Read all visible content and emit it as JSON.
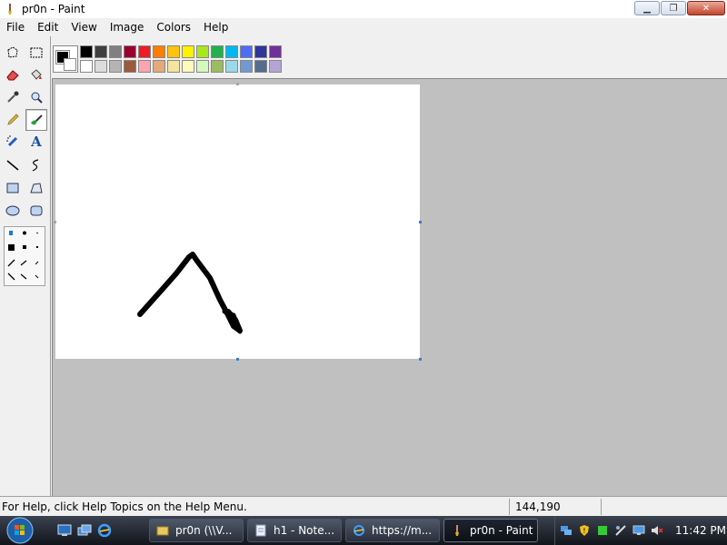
{
  "window": {
    "title": "pr0n - Paint",
    "minimize_icon": "minimize-icon",
    "restore_icon": "restore-icon",
    "close_icon": "close-icon"
  },
  "menu": [
    "File",
    "Edit",
    "View",
    "Image",
    "Colors",
    "Help"
  ],
  "tools": [
    {
      "name": "free-form-select-tool",
      "icon": "star-select-icon"
    },
    {
      "name": "select-tool",
      "icon": "rect-select-icon"
    },
    {
      "name": "eraser-tool",
      "icon": "eraser-icon"
    },
    {
      "name": "fill-tool",
      "icon": "paint-bucket-icon"
    },
    {
      "name": "pick-color-tool",
      "icon": "eyedropper-icon"
    },
    {
      "name": "magnifier-tool",
      "icon": "magnifier-icon"
    },
    {
      "name": "pencil-tool",
      "icon": "pencil-icon"
    },
    {
      "name": "brush-tool",
      "icon": "brush-icon"
    },
    {
      "name": "airbrush-tool",
      "icon": "airbrush-icon"
    },
    {
      "name": "text-tool",
      "icon": "text-icon",
      "glyph": "A"
    },
    {
      "name": "line-tool",
      "icon": "line-icon"
    },
    {
      "name": "curve-tool",
      "icon": "curve-icon"
    },
    {
      "name": "rectangle-tool",
      "icon": "rectangle-icon"
    },
    {
      "name": "polygon-tool",
      "icon": "polygon-icon"
    },
    {
      "name": "ellipse-tool",
      "icon": "ellipse-icon"
    },
    {
      "name": "rounded-rectangle-tool",
      "icon": "rounded-rect-icon"
    }
  ],
  "selected_tool": "brush-tool",
  "current_colors": {
    "foreground": "#000000",
    "background": "#ffffff"
  },
  "palette": {
    "row1": [
      "#000000",
      "#404040",
      "#808080",
      "#990030",
      "#ed1c24",
      "#ff7e00",
      "#ffc20e",
      "#fff200",
      "#a8e61d",
      "#22b14c",
      "#00b7ef",
      "#4d6df3",
      "#2f3699",
      "#6f3198"
    ],
    "row2": [
      "#ffffff",
      "#dcdcdc",
      "#b4b4b4",
      "#9c5a3c",
      "#ffa3b1",
      "#e5aa7a",
      "#f5e49c",
      "#fff9bd",
      "#d3f9bc",
      "#9dbb61",
      "#99d9ea",
      "#709ad1",
      "#546d8e",
      "#b5a5d5"
    ]
  },
  "status": {
    "help_text": "For Help, click Help Topics on the Help Menu.",
    "coordinates": "144,190"
  },
  "taskbar": {
    "start_icon": "windows-start-icon",
    "quick_launch": [
      "show-desktop-icon",
      "switch-windows-icon",
      "internet-explorer-icon"
    ],
    "buttons": [
      {
        "label": "pr0n (\\\\V...",
        "icon": "folder-icon",
        "active": false
      },
      {
        "label": "h1 - Note...",
        "icon": "notepad-icon",
        "active": false
      },
      {
        "label": "https://m...",
        "icon": "internet-explorer-icon",
        "active": false
      },
      {
        "label": "pr0n - Paint",
        "icon": "paint-icon",
        "active": true
      }
    ],
    "tray_icons": [
      "network-icon",
      "security-shield-icon",
      "update-icon",
      "sync-icon",
      "display-icon",
      "volume-muted-icon"
    ],
    "clock": "11:42 PM"
  }
}
